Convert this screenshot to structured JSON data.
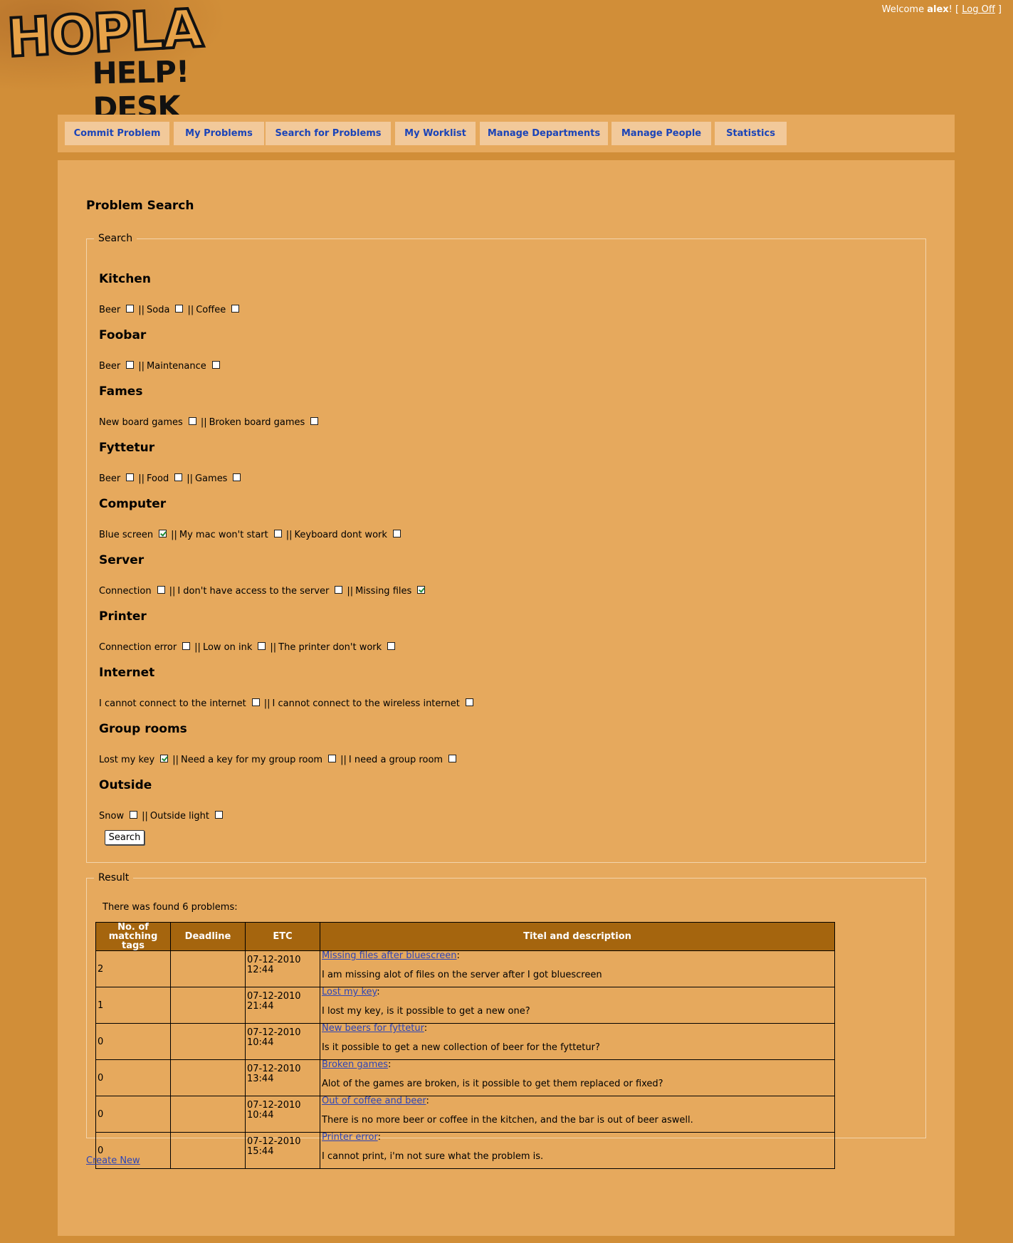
{
  "logo": {
    "title": "HOPLA",
    "subtitle": "HELP! DESK"
  },
  "user": {
    "welcome_prefix": "Welcome ",
    "name": "alex",
    "welcome_suffix": "! [ ",
    "logoff": "Log Off",
    "close": " ]"
  },
  "menu": [
    "Commit Problem",
    "My Problems",
    "Search for Problems",
    "My Worklist",
    "Manage Departments",
    "Manage People",
    "Statistics"
  ],
  "page_title": "Problem Search",
  "search": {
    "legend": "Search",
    "button": "Search",
    "separator": "||",
    "categories": [
      {
        "name": "Kitchen",
        "tags": [
          {
            "label": "Beer",
            "checked": false
          },
          {
            "label": "Soda",
            "checked": false
          },
          {
            "label": "Coffee",
            "checked": false
          }
        ]
      },
      {
        "name": "Foobar",
        "tags": [
          {
            "label": "Beer",
            "checked": false
          },
          {
            "label": "Maintenance",
            "checked": false
          }
        ]
      },
      {
        "name": "Fames",
        "tags": [
          {
            "label": "New board games",
            "checked": false
          },
          {
            "label": "Broken board games",
            "checked": false
          }
        ]
      },
      {
        "name": "Fyttetur",
        "tags": [
          {
            "label": "Beer",
            "checked": false
          },
          {
            "label": "Food",
            "checked": false
          },
          {
            "label": "Games",
            "checked": false
          }
        ]
      },
      {
        "name": "Computer",
        "tags": [
          {
            "label": "Blue screen",
            "checked": true
          },
          {
            "label": "My mac won't start",
            "checked": false
          },
          {
            "label": "Keyboard dont work",
            "checked": false
          }
        ]
      },
      {
        "name": "Server",
        "tags": [
          {
            "label": "Connection",
            "checked": false
          },
          {
            "label": "I don't have access to the server",
            "checked": false
          },
          {
            "label": "Missing files",
            "checked": true
          }
        ]
      },
      {
        "name": "Printer",
        "tags": [
          {
            "label": "Connection error",
            "checked": false
          },
          {
            "label": "Low on ink",
            "checked": false
          },
          {
            "label": "The printer don't work",
            "checked": false
          }
        ]
      },
      {
        "name": "Internet",
        "tags": [
          {
            "label": "I cannot connect to the internet",
            "checked": false
          },
          {
            "label": "I cannot connect to the wireless internet",
            "checked": false
          }
        ]
      },
      {
        "name": "Group rooms",
        "tags": [
          {
            "label": "Lost my key",
            "checked": true
          },
          {
            "label": "Need a key for my group room",
            "checked": false
          },
          {
            "label": "I need a group room",
            "checked": false
          }
        ]
      },
      {
        "name": "Outside",
        "tags": [
          {
            "label": "Snow",
            "checked": false
          },
          {
            "label": "Outside light",
            "checked": false
          }
        ]
      }
    ]
  },
  "result": {
    "legend": "Result",
    "found_text": "There was found 6 problems:",
    "headers": {
      "matching": "No. of matching tags",
      "deadline": "Deadline",
      "etc": "ETC",
      "title": "Titel and description"
    },
    "rows": [
      {
        "matching": "2",
        "deadline": "",
        "etc_date": "07-12-2010",
        "etc_time": "12:44",
        "title": "Missing files after bluescreen",
        "desc": "I am missing alot of files on the server after I got bluescreen"
      },
      {
        "matching": "1",
        "deadline": "",
        "etc_date": "07-12-2010",
        "etc_time": "21:44",
        "title": "Lost my key",
        "desc": "I lost my key, is it possible to get a new one?"
      },
      {
        "matching": "0",
        "deadline": "",
        "etc_date": "07-12-2010",
        "etc_time": "10:44",
        "title": "New beers for fyttetur",
        "desc": "Is it possible to get a new collection of beer for the fyttetur?"
      },
      {
        "matching": "0",
        "deadline": "",
        "etc_date": "07-12-2010",
        "etc_time": "13:44",
        "title": "Broken games",
        "desc": "Alot of the games are broken, is it possible to get them replaced or fixed?"
      },
      {
        "matching": "0",
        "deadline": "",
        "etc_date": "07-12-2010",
        "etc_time": "10:44",
        "title": "Out of coffee and beer",
        "desc": "There is no more beer or coffee in the kitchen, and the bar is out of beer aswell."
      },
      {
        "matching": "0",
        "deadline": "",
        "etc_date": "07-12-2010",
        "etc_time": "15:44",
        "title": "Printer error",
        "desc": "I cannot print, i'm not sure what the problem is."
      }
    ]
  },
  "create_new": "Create New"
}
